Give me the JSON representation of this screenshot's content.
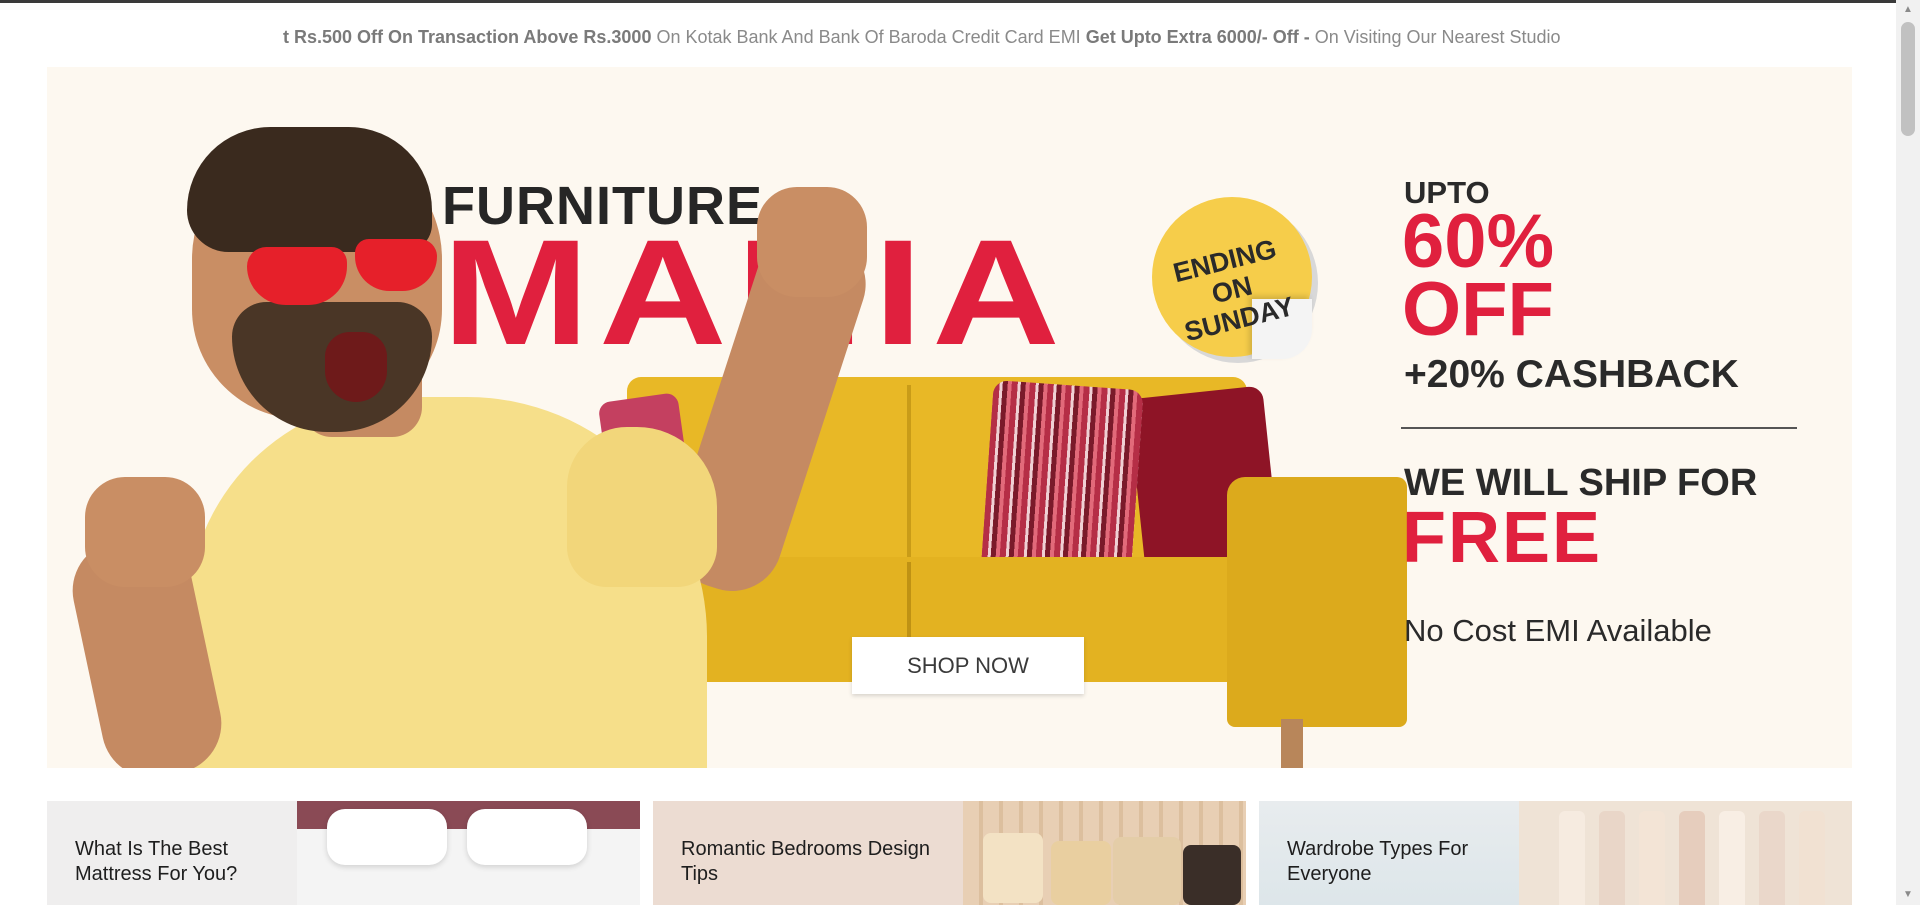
{
  "ticker": {
    "segments": [
      {
        "text": "t Rs.500 Off On Transaction Above Rs.3000",
        "bold": true
      },
      {
        "text": " On Kotak Bank And Bank Of Baroda Credit Card EMI ",
        "bold": false
      },
      {
        "text": "Get Upto Extra 6000/- Off -",
        "bold": true
      },
      {
        "text": " On Visiting Our Nearest Studio",
        "bold": false
      }
    ]
  },
  "hero": {
    "headline_small": "FURNITURE",
    "headline_big": "MANIA",
    "sticker": "ENDING ON SUNDAY",
    "cta": "SHOP NOW",
    "offer": {
      "upto": "UPTO",
      "percent": "60%",
      "off": "OFF",
      "cashback": "+20% CASHBACK",
      "ship_line": "WE WILL SHIP FOR",
      "free": "FREE",
      "emi": "No Cost EMI Available"
    },
    "colors": {
      "accent": "#e0203e",
      "background": "#fdf8f0",
      "sofa": "#e3b221"
    }
  },
  "blog_cards": [
    {
      "title": "What Is The Best Mattress For You?"
    },
    {
      "title": "Romantic Bedrooms Design Tips"
    },
    {
      "title": "Wardrobe Types For Everyone"
    }
  ],
  "icons": {
    "scroll_up": "scroll-up-arrow-icon",
    "scroll_down": "scroll-down-arrow-icon"
  }
}
